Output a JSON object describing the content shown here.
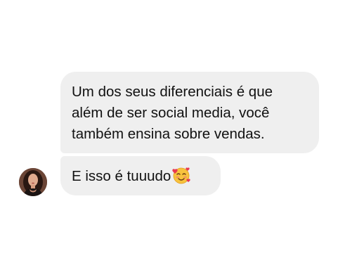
{
  "chat": {
    "messages": [
      {
        "lines": [
          "Um dos seus diferenciais é que",
          "além de ser social media, você",
          "também ensina sobre vendas."
        ]
      },
      {
        "text": "E isso é tuuudo",
        "emoji": "smiling-face-with-hearts-icon"
      }
    ],
    "colors": {
      "bubble": "#efefef",
      "text": "#111111",
      "background": "#ffffff"
    }
  }
}
